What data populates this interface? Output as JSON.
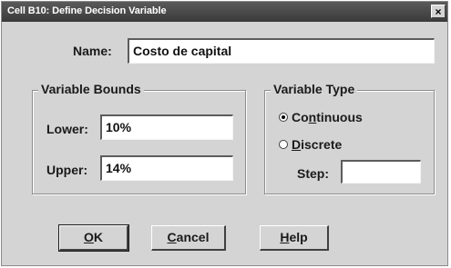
{
  "window": {
    "title": "Cell B10: Define Decision Variable",
    "close_glyph": "×"
  },
  "name_field": {
    "label": "Name:",
    "value": "Costo de capital"
  },
  "bounds": {
    "title": "Variable Bounds",
    "lower_label": "Lower:",
    "lower_value": "10%",
    "upper_label": "Upper:",
    "upper_value": "14%"
  },
  "type": {
    "title": "Variable Type",
    "continuous": {
      "pre": "Co",
      "key": "n",
      "post": "tinuous",
      "selected": true
    },
    "discrete": {
      "pre": "",
      "key": "D",
      "post": "iscrete",
      "selected": false
    },
    "step_label": "Step:",
    "step_value": ""
  },
  "buttons": {
    "ok": {
      "key": "O",
      "post": "K"
    },
    "cancel": {
      "key": "C",
      "post": "ancel"
    },
    "help": {
      "key": "H",
      "post": "elp"
    }
  }
}
